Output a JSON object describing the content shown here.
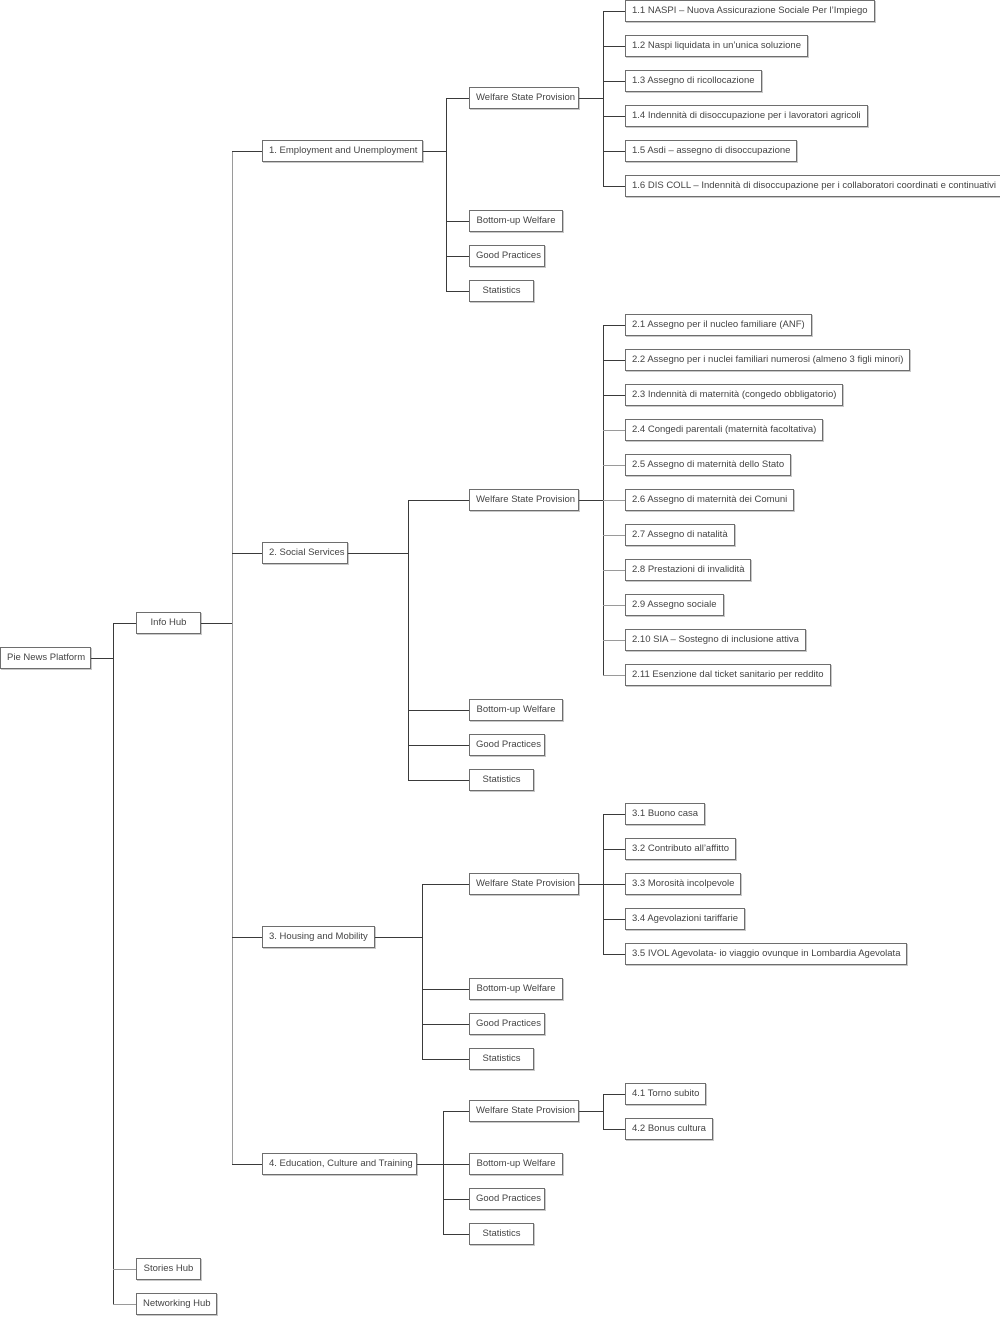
{
  "diagram": {
    "title": "Pie News Platform",
    "root": {
      "label": "Pie News Platform",
      "children": [
        {
          "label": "Info Hub",
          "children": [
            {
              "label": "1. Employment and Unemployment",
              "children": [
                {
                  "label": "Welfare State Provision",
                  "children": [
                    {
                      "label": "1.1 NASPI – Nuova Assicurazione Sociale Per l’Impiego"
                    },
                    {
                      "label": "1.2 Naspi liquidata in un’unica soluzione"
                    },
                    {
                      "label": "1.3 Assegno di ricollocazione"
                    },
                    {
                      "label": "1.4 Indennità di disoccupazione per i lavoratori agricoli"
                    },
                    {
                      "label": "1.5 Asdi – assegno di disoccupazione"
                    },
                    {
                      "label": "1.6 DIS COLL – Indennità di disoccupazione per i collaboratori coordinati e continuativi"
                    }
                  ]
                },
                {
                  "label": "Bottom-up Welfare"
                },
                {
                  "label": "Good Practices"
                },
                {
                  "label": "Statistics"
                }
              ]
            },
            {
              "label": "2. Social Services",
              "children": [
                {
                  "label": "Welfare State Provision",
                  "children": [
                    {
                      "label": "2.1 Assegno per il nucleo familiare (ANF)"
                    },
                    {
                      "label": "2.2 Assegno per i nuclei familiari numerosi (almeno 3 figli minori)"
                    },
                    {
                      "label": "2.3 Indennità di maternità (congedo obbligatorio)"
                    },
                    {
                      "label": "2.4 Congedi parentali (maternità facoltativa)"
                    },
                    {
                      "label": "2.5 Assegno di maternità dello Stato"
                    },
                    {
                      "label": "2.6 Assegno di maternità dei Comuni"
                    },
                    {
                      "label": "2.7 Assegno di natalità"
                    },
                    {
                      "label": "2.8 Prestazioni di invalidità"
                    },
                    {
                      "label": "2.9 Assegno sociale"
                    },
                    {
                      "label": "2.10 SIA – Sostegno di inclusione attiva"
                    },
                    {
                      "label": "2.11 Esenzione dal ticket sanitario per reddito"
                    }
                  ]
                },
                {
                  "label": "Bottom-up Welfare"
                },
                {
                  "label": "Good Practices"
                },
                {
                  "label": "Statistics"
                }
              ]
            },
            {
              "label": "3. Housing and Mobility",
              "children": [
                {
                  "label": "Welfare State Provision",
                  "children": [
                    {
                      "label": "3.1 Buono casa"
                    },
                    {
                      "label": "3.2 Contributo all’affitto"
                    },
                    {
                      "label": "3.3 Morosità incolpevole"
                    },
                    {
                      "label": "3.4 Agevolazioni tariffarie"
                    },
                    {
                      "label": "3.5 IVOL Agevolata- io viaggio ovunque in Lombardia Agevolata"
                    }
                  ]
                },
                {
                  "label": "Bottom-up Welfare"
                },
                {
                  "label": "Good Practices"
                },
                {
                  "label": "Statistics"
                }
              ]
            },
            {
              "label": "4. Education, Culture and Training",
              "children": [
                {
                  "label": "Welfare State Provision",
                  "children": [
                    {
                      "label": "4.1 Torno subito"
                    },
                    {
                      "label": "4.2 Bonus cultura"
                    }
                  ]
                },
                {
                  "label": "Bottom-up Welfare"
                },
                {
                  "label": "Good Practices"
                },
                {
                  "label": "Statistics"
                }
              ]
            }
          ]
        },
        {
          "label": "Stories Hub"
        },
        {
          "label": "Networking Hub"
        }
      ]
    }
  }
}
